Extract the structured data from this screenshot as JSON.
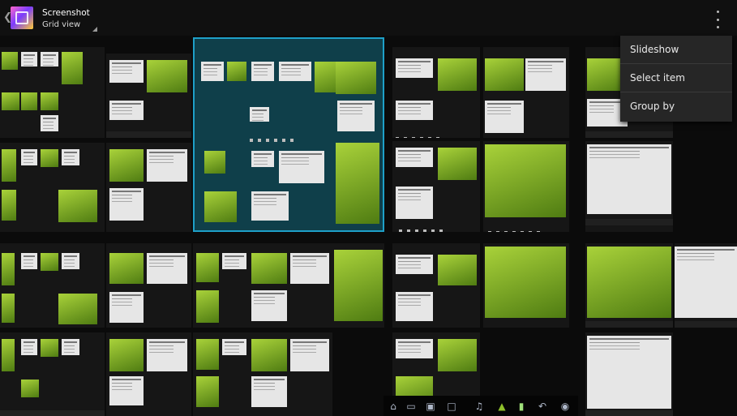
{
  "action_bar": {
    "title": "Screenshot",
    "subtitle": "Grid view",
    "back_icon": "chevron-left-icon",
    "app_icon": "gallery-icon",
    "overflow_icon": "overflow-menu-icon"
  },
  "menu": {
    "items": [
      {
        "label": "Slideshow"
      },
      {
        "label": "Select item"
      },
      {
        "label": "Group by"
      }
    ]
  },
  "navbar": {
    "icons": [
      "home-icon",
      "recent-apps-icon",
      "screenshot-icon",
      "monitor-icon",
      "volume-icon",
      "android-icon",
      "battery-icon",
      "back-icon",
      "camera-icon"
    ]
  },
  "colors": {
    "selection": "#1ea0c8",
    "menu_bg": "#262626",
    "thumbnail_green": "#8fc02b"
  }
}
